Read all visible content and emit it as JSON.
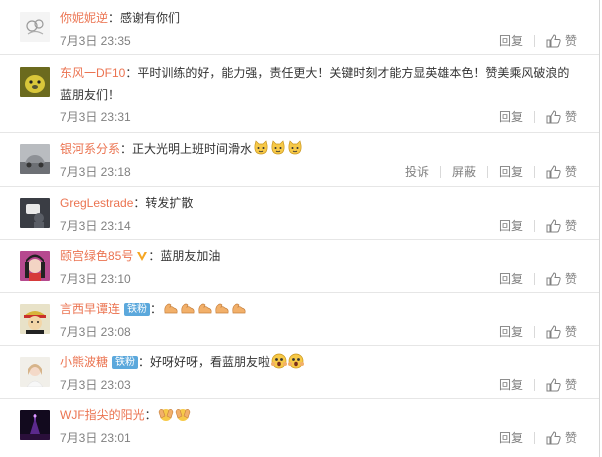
{
  "colors": {
    "username": "#eb7350",
    "meta": "#808080",
    "badge_fan": "#5ba8dc",
    "verified": "#f5a623"
  },
  "actions": {
    "reply": "回复",
    "like": "赞",
    "report": "投诉",
    "block": "屏蔽"
  },
  "comments": [
    {
      "user": "你妮妮逆",
      "colon": "：",
      "text": "感谢有你们",
      "time": "7月3日 23:35",
      "avatar_icon": "doodle-avatar-icon"
    },
    {
      "user": "东风一DF10",
      "colon": "：",
      "text_line1": "平时训练的好，能力强，责任更大！关键时刻才能方显英雄本色！赞美乘风破浪的",
      "text_line2": "蓝朋友们！",
      "time": "7月3日 23:31",
      "avatar_icon": "yellow-dog-avatar-icon"
    },
    {
      "user": "银河系分系",
      "colon": "：",
      "text": "正大光明上班时间滑水",
      "emojis": [
        "cat-emoji-icon",
        "cat-emoji-icon",
        "cat-emoji-icon"
      ],
      "time": "7月3日 23:18",
      "avatar_icon": "car-photo-avatar-icon"
    },
    {
      "user": "GregLestrade",
      "colon": "：",
      "text": "转发扩散",
      "time": "7月3日 23:14",
      "avatar_icon": "dark-figure-avatar-icon"
    },
    {
      "user": "颐宫绿色85号",
      "colon": "：",
      "text": "蓝朋友加油",
      "time": "7月3日 23:10",
      "avatar_icon": "anime-girl-avatar-icon",
      "badge": "verified-v-icon"
    },
    {
      "user": "言西早谭连",
      "colon": "：",
      "text": "",
      "fan_badge": "铁粉",
      "emojis": [
        "flex-arm-emoji-icon",
        "flex-arm-emoji-icon",
        "flex-arm-emoji-icon",
        "flex-arm-emoji-icon",
        "flex-arm-emoji-icon"
      ],
      "time": "7月3日 23:08",
      "avatar_icon": "cartoon-pirate-avatar-icon"
    },
    {
      "user": "小熊波糖",
      "colon": "：",
      "text": "好呀好呀，看蓝朋友啦",
      "fan_badge": "铁粉",
      "emojis": [
        "surprised-emoji-icon",
        "surprised-emoji-icon"
      ],
      "time": "7月3日 23:03",
      "avatar_icon": "girl-photo-avatar-icon"
    },
    {
      "user": "WJF指尖的阳光",
      "colon": "：",
      "text": "",
      "emojis": [
        "hands-emoji-icon",
        "hands-emoji-icon"
      ],
      "time": "7月3日 23:01",
      "avatar_icon": "night-tower-avatar-icon"
    }
  ]
}
